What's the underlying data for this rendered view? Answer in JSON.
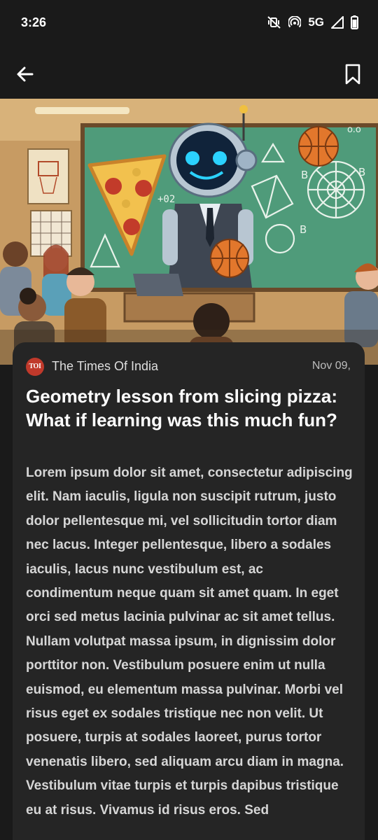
{
  "status_bar": {
    "time": "3:26",
    "network": "5G",
    "icons": [
      "mute-vibrate-icon",
      "hotspot-icon",
      "signal-icon",
      "battery-icon"
    ]
  },
  "app_bar": {
    "back_icon": "arrow-left-icon",
    "bookmark_icon": "bookmark-icon"
  },
  "article": {
    "source_logo": "TOI",
    "source_name": "The Times Of India",
    "date": "Nov 09,",
    "headline": "Geometry lesson from slicing pizza: What if learning was this much fun?",
    "body": "Lorem ipsum dolor sit amet, consectetur adipiscing elit. Nam iaculis, ligula non suscipit rutrum, justo dolor pellentesque mi, vel sollicitudin tortor diam nec lacus. Integer pellentesque, libero a sodales iaculis, lacus nunc vestibulum est, ac condimentum neque quam sit amet quam. In eget orci sed metus lacinia pulvinar ac sit amet tellus. Nullam volutpat massa ipsum, in dignissim dolor porttitor non. Vestibulum posuere enim ut nulla euismod, eu elementum massa pulvinar. Morbi vel risus eget ex sodales tristique nec non velit. Ut posuere, turpis at sodales laoreet, purus tortor venenatis libero, sed aliquam arcu diam in magna. Vestibulum vitae turpis et turpis dapibus tristique eu at risus. Vivamus id risus eros. Sed"
  },
  "colors": {
    "background": "#1a1a1a",
    "card": "#252525",
    "toi_red": "#c0392b",
    "chalkboard": "#4f9b7a"
  }
}
